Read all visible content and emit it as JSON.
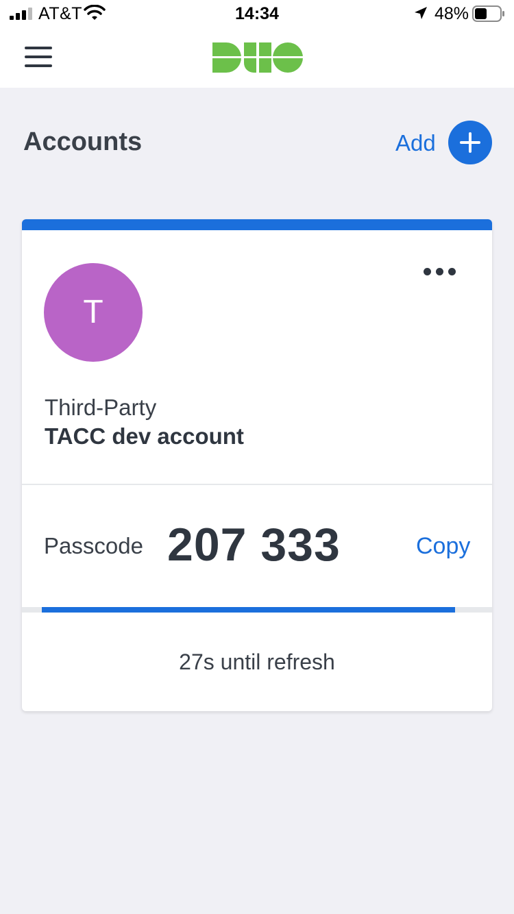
{
  "status_bar": {
    "carrier": "AT&T",
    "time": "14:34",
    "battery_percent": "48%",
    "battery_level": 0.48,
    "signal_icon": "cellular-signal-icon",
    "wifi_icon": "wifi-icon",
    "location_icon": "location-arrow-icon",
    "battery_icon": "battery-icon"
  },
  "nav": {
    "menu_icon": "hamburger-menu-icon",
    "logo": "DUO",
    "logo_color": "#6cc04a"
  },
  "header": {
    "title": "Accounts",
    "add_label": "Add",
    "add_icon": "plus-icon"
  },
  "account": {
    "avatar_letter": "T",
    "avatar_color": "#b964c7",
    "more_icon": "more-options-icon",
    "type": "Third-Party",
    "name": "TACC dev account",
    "passcode_label": "Passcode",
    "passcode": "207 333",
    "copy_label": "Copy",
    "refresh_text": "27s until refresh",
    "refresh_progress": 0.96
  },
  "colors": {
    "accent": "#1b6fdc",
    "background": "#f0f0f5",
    "text": "#2f3640"
  }
}
